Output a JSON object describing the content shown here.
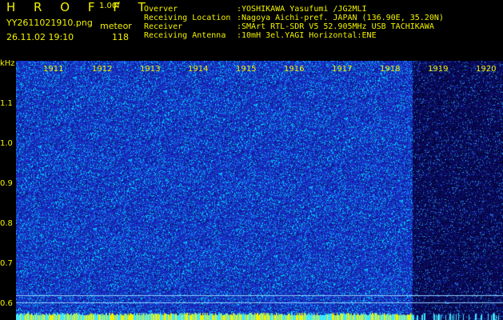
{
  "header": {
    "title": "H R O F F T",
    "version": "1.00f",
    "filename": "YY2611021910.png",
    "mode": "meteor",
    "datetime": "26.11.02 19:10",
    "count": "118",
    "info": [
      {
        "label": "Overver",
        "value": ":YOSHIKAWA Yasufumi /JG2MLI"
      },
      {
        "label": "Receiving Location",
        "value": ":Nagoya Aichi-pref. JAPAN (136.90E, 35.20N)"
      },
      {
        "label": "Receiver",
        "value": ":SMArt RTL-SDR V5 52.905MHz USB TACHIKAWA"
      },
      {
        "label": "Receiving Antenna",
        "value": ":10mH 3el.YAGI Horizontal:ENE"
      }
    ]
  },
  "plot": {
    "unit": "kHz",
    "y_ticks": [
      "1.1",
      "1.0",
      "0.9",
      "0.8",
      "0.7",
      "0.6"
    ],
    "time_labels": [
      "1911",
      "1912",
      "1913",
      "1914",
      "1915",
      "1916",
      "1917",
      "1918",
      "1919",
      "1920"
    ],
    "colors": {
      "background": "#1a2ec8",
      "background_dark": "#0a0a5a",
      "noise": "#00e0ff",
      "label": "#f2f200"
    }
  }
}
